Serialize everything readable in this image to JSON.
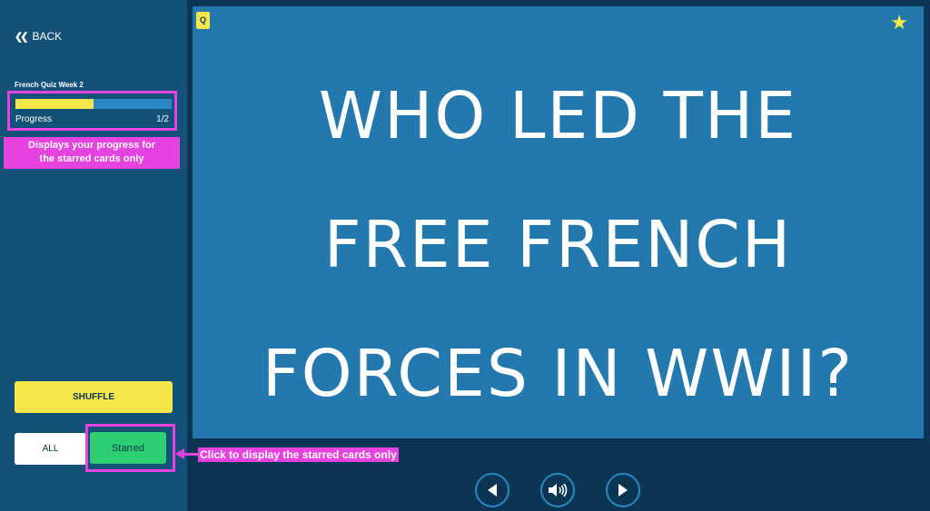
{
  "sidebar": {
    "back_label": "BACK",
    "deck_title": "French Quiz Week 2",
    "progress": {
      "label": "Progress",
      "count": "1/2",
      "fraction": 0.5
    },
    "progress_callout": "Displays your progress for\nthe starred cards only",
    "shuffle_label": "SHUFFLE",
    "all_label": "ALL",
    "starred_label": "Starred",
    "starred_callout": "Click to display the starred cards only"
  },
  "card": {
    "badge": "Q",
    "question": "WHO LED THE\nFREE FRENCH\nFORCES IN WWII?",
    "star_icon": "star-icon"
  },
  "colors": {
    "background": "#0b3552",
    "sidebar": "#135179",
    "card": "#2379ad",
    "accent_yellow": "#f5e649",
    "accent_green": "#2ecf73",
    "annotation_magenta": "#e542e0"
  }
}
